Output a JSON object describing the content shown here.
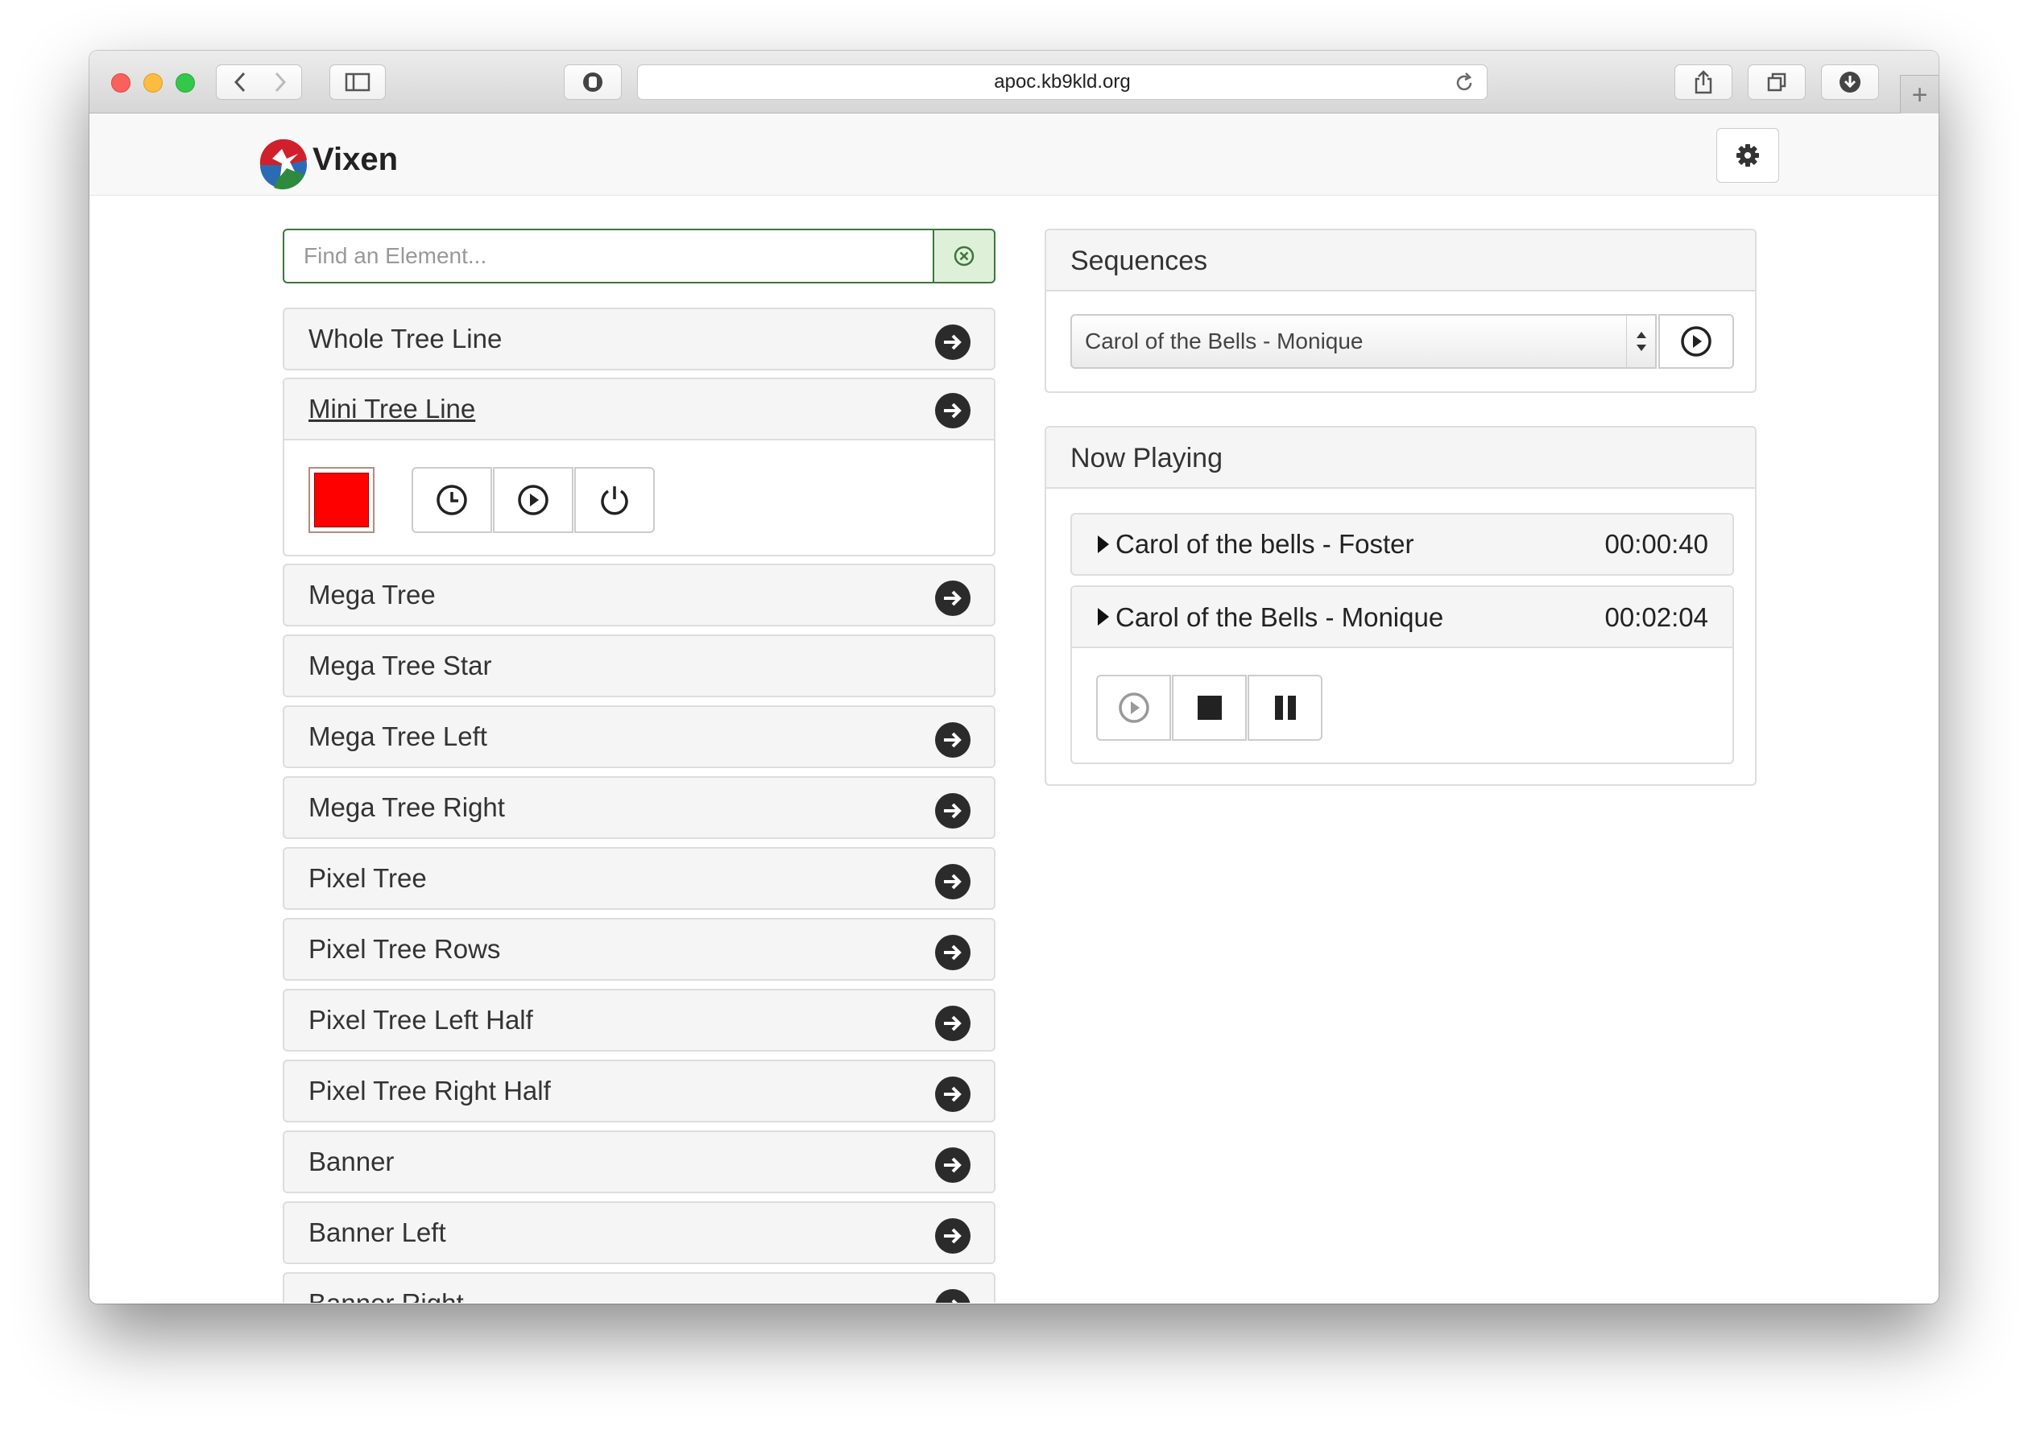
{
  "browser": {
    "url": "apoc.kb9kld.org",
    "new_tab_label": "+"
  },
  "app": {
    "brand": "Vixen",
    "colors": {
      "accent_green": "#3c763d",
      "swatch_red": "#ff0000"
    }
  },
  "elements": {
    "search_placeholder": "Find an Element...",
    "items": [
      {
        "label": "Whole Tree Line",
        "has_children": true
      },
      {
        "label": "Mini Tree Line",
        "has_children": true,
        "expanded": true
      },
      {
        "label": "Mega Tree",
        "has_children": true
      },
      {
        "label": "Mega Tree Star",
        "has_children": false
      },
      {
        "label": "Mega Tree Left",
        "has_children": true
      },
      {
        "label": "Mega Tree Right",
        "has_children": true
      },
      {
        "label": "Pixel Tree",
        "has_children": true
      },
      {
        "label": "Pixel Tree Rows",
        "has_children": true
      },
      {
        "label": "Pixel Tree Left Half",
        "has_children": true
      },
      {
        "label": "Pixel Tree Right Half",
        "has_children": true
      },
      {
        "label": "Banner",
        "has_children": true
      },
      {
        "label": "Banner Left",
        "has_children": true
      },
      {
        "label": "Banner Right",
        "has_children": true
      }
    ],
    "controls": [
      "timer-icon",
      "play-circle-icon",
      "power-icon"
    ]
  },
  "sequences": {
    "title": "Sequences",
    "selected": "Carol of the Bells - Monique"
  },
  "now_playing": {
    "title": "Now Playing",
    "items": [
      {
        "title": "Carol of the bells - Foster",
        "time": "00:00:40"
      },
      {
        "title": "Carol of the Bells - Monique",
        "time": "00:02:04"
      }
    ],
    "controls": [
      "play-circle-icon",
      "stop-icon",
      "pause-icon"
    ]
  }
}
